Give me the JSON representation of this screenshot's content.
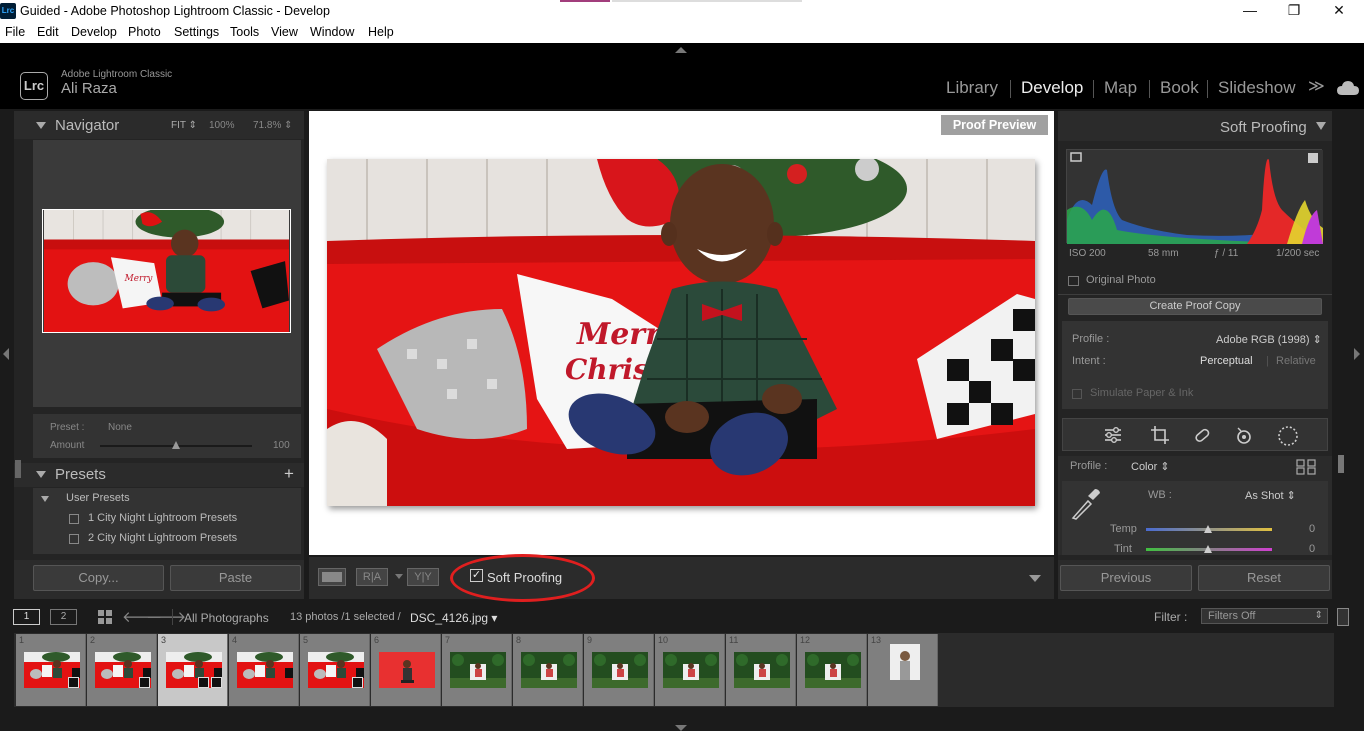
{
  "window": {
    "title": "Guided - Adobe Photoshop Lightroom Classic - Develop",
    "app_icon_label": "Lrc",
    "controls": {
      "minimize": "—",
      "maximize": "❐",
      "close": "✕"
    }
  },
  "menubar": [
    "File",
    "Edit",
    "Develop",
    "Photo",
    "Settings",
    "Tools",
    "View",
    "Window",
    "Help"
  ],
  "header": {
    "logo": "Lrc",
    "app_name": "Adobe Lightroom Classic",
    "user": "Ali Raza",
    "modules": [
      "Library",
      "Develop",
      "Map",
      "Book",
      "Slideshow"
    ],
    "active_module": "Develop",
    "more": "≫"
  },
  "navigator": {
    "title": "Navigator",
    "zoom": [
      "FIT ⇕",
      "100%",
      "71.8% ⇕"
    ]
  },
  "preset_amount": {
    "preset_label": "Preset :",
    "preset_value": "None",
    "amount_label": "Amount",
    "amount_value": "100",
    "amount_fraction": 0.5
  },
  "presets": {
    "title": "Presets",
    "add": "+",
    "group": "User Presets",
    "items": [
      "1 City Night Lightroom Presets",
      "2 City Night Lightroom Presets"
    ]
  },
  "left_buttons": {
    "copy": "Copy...",
    "paste": "Paste"
  },
  "center": {
    "proof_badge": "Proof Preview"
  },
  "toolbar": {
    "compare1": "R|A",
    "compare2": "Y|Y",
    "soft_proofing_label": "Soft Proofing",
    "soft_proofing_checked": true
  },
  "soft_proofing": {
    "title": "Soft Proofing",
    "histogram_info": [
      "ISO 200",
      "58 mm",
      "ƒ / 11",
      "1/200 sec"
    ],
    "original_photo": "Original Photo",
    "create_proof_copy": "Create Proof Copy",
    "profile_label": "Profile :",
    "profile_value": "Adobe RGB (1998) ⇕",
    "intent_label": "Intent :",
    "intent_options": [
      "Perceptual",
      "Relative"
    ],
    "intent_selected": "Perceptual",
    "simulate": "Simulate Paper & Ink"
  },
  "basic": {
    "profile_label": "Profile :",
    "profile_value": "Color ⇕",
    "wb_label": "WB :",
    "wb_value": "As Shot ⇕",
    "temp_label": "Temp",
    "temp_value": "0",
    "tint_label": "Tint",
    "tint_value": "0"
  },
  "right_buttons": {
    "previous": "Previous",
    "reset": "Reset"
  },
  "filmstrip": {
    "page1": "1",
    "page2": "2",
    "source": "All Photographs",
    "count": "13 photos /1 selected /",
    "filename": "DSC_4126.jpg ▾",
    "filter_label": "Filter :",
    "filter_value": "Filters Off",
    "thumbs": [
      "1",
      "2",
      "3",
      "4",
      "5",
      "6",
      "7",
      "8",
      "9",
      "10",
      "11",
      "12",
      "13"
    ],
    "selected": "3"
  },
  "colors": {
    "accent_red": "#e01f1f",
    "panel_bg": "#333333",
    "app_bg": "#1b1b1b"
  }
}
